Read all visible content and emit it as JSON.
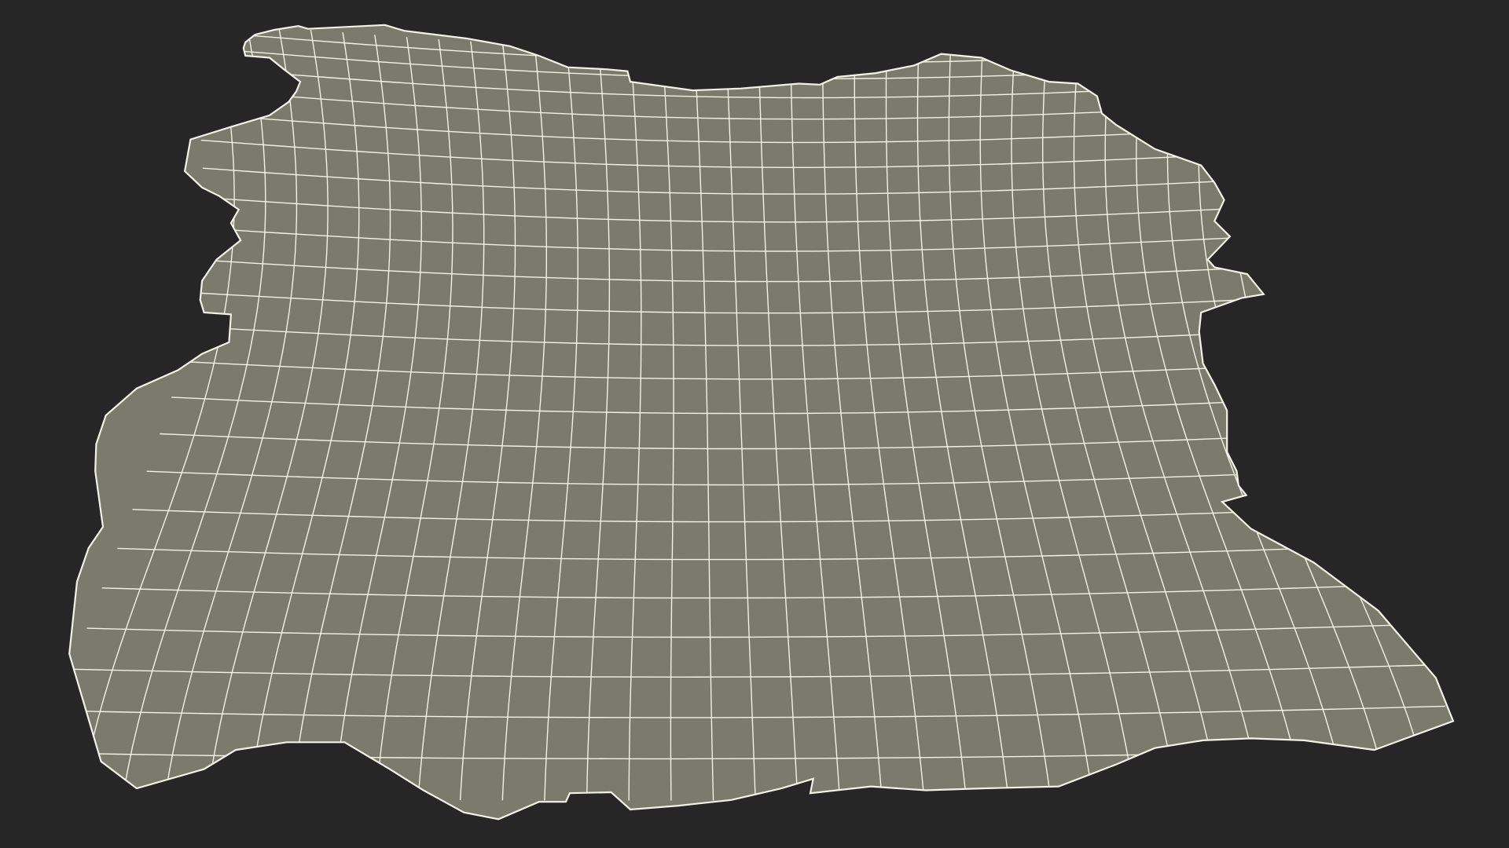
{
  "scene": {
    "background_color": "#262626",
    "mesh_fill_color": "#7a7b6d",
    "wire_color": "#f2f2e6",
    "object": "wireframe-leather-hide-mesh"
  }
}
